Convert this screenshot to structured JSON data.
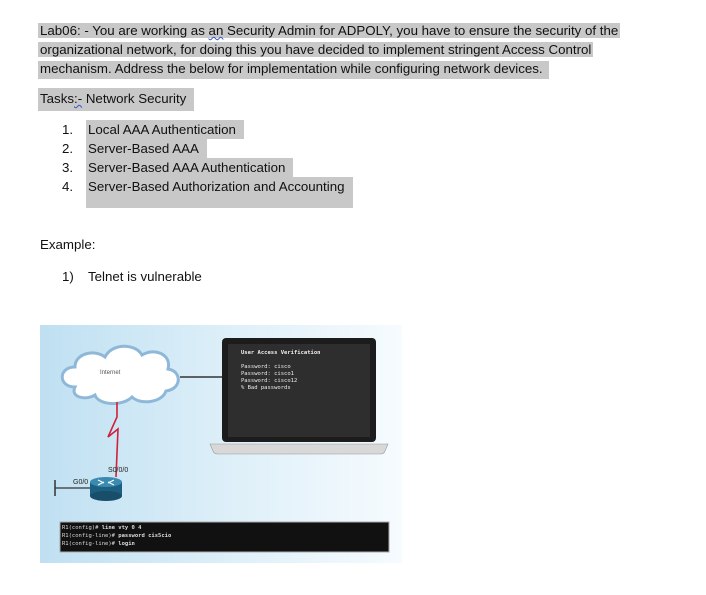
{
  "doc": {
    "intro_lines": [
      "Lab06: - You are working as ",
      "an",
      " Security Admin for ADPOLY, you have to ensure the security of the",
      "organizational network, for doing this you have decided to implement stringent Access Control",
      "mechanism. Address the below for implementation while configuring network devices."
    ],
    "tasks_prefix": "Tasks",
    "tasks_sq": ":-",
    "tasks_title": " Network Security",
    "tasks": [
      {
        "num": "1.",
        "label": "Local AAA Authentication"
      },
      {
        "num": "2.",
        "label": "Server-Based AAA"
      },
      {
        "num": "3.",
        "label": "Server-Based AAA Authentication"
      },
      {
        "num": "4.",
        "label": "Server-Based Authorization and Accounting"
      }
    ],
    "example_label": "Example:",
    "example_item": {
      "num": "1)",
      "label": "Telnet is vulnerable"
    }
  },
  "figure": {
    "cloud_label": "Internet",
    "serial_label": "S0/0/0",
    "gig_label": "G0/0",
    "laptop_lines": [
      "User Access Verification",
      "",
      "Password: cisco",
      "Password: cisco1",
      "Password: cisco12",
      "% Bad passwords"
    ],
    "router_lines": [
      {
        "prompt": "R1(config)# ",
        "cmd": "line vty 0 4"
      },
      {
        "prompt": "R1(config-line)# ",
        "cmd": "password cis5cio"
      },
      {
        "prompt": "R1(config-line)# ",
        "cmd": "login"
      }
    ],
    "colors": {
      "serial_link": "#d0203a",
      "terminal_bg": "#2a2a2a"
    }
  }
}
